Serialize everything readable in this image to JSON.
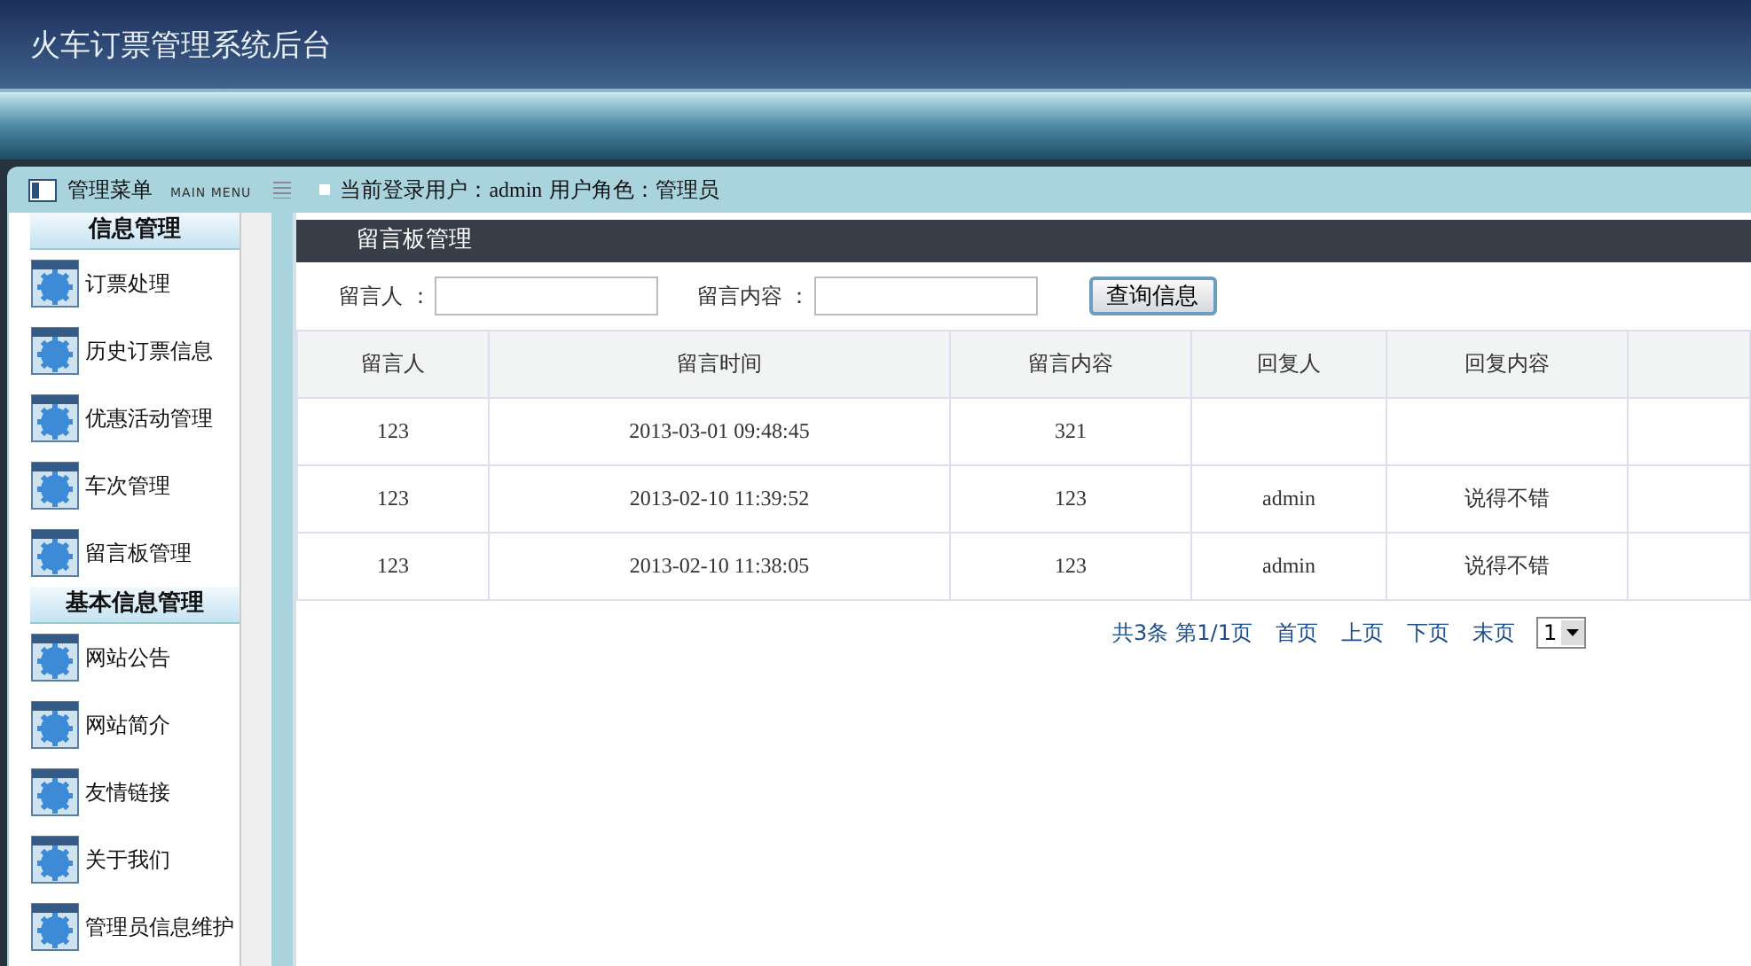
{
  "header": {
    "title": "火车订票管理系统后台"
  },
  "menu_bar": {
    "title": "管理菜单",
    "subtitle": "MAIN MENU",
    "user_info_label": "当前登录用户：",
    "user": "admin",
    "role_label": "用户角色：",
    "role": "管理员"
  },
  "sidebar": {
    "groups": [
      {
        "title": "信息管理",
        "items": [
          "订票处理",
          "历史订票信息",
          "优惠活动管理",
          "车次管理",
          "留言板管理"
        ]
      },
      {
        "title": "基本信息管理",
        "items": [
          "网站公告",
          "网站简介",
          "友情链接",
          "关于我们",
          "管理员信息维护"
        ]
      }
    ]
  },
  "panel": {
    "title": "留言板管理"
  },
  "search": {
    "fields": [
      {
        "label": "留言人 ："
      },
      {
        "label": "留言内容 ："
      }
    ],
    "button": "查询信息"
  },
  "table": {
    "columns": [
      "留言人",
      "留言时间",
      "留言内容",
      "回复人",
      "回复内容"
    ],
    "rows": [
      [
        "123",
        "2013-03-01 09:48:45",
        "321",
        "",
        ""
      ],
      [
        "123",
        "2013-02-10 11:39:52",
        "123",
        "admin",
        "说得不错"
      ],
      [
        "123",
        "2013-02-10 11:38:05",
        "123",
        "admin",
        "说得不错"
      ]
    ]
  },
  "pagination": {
    "total": "共3条",
    "page": "第1/1页",
    "links": [
      "首页",
      "上页",
      "下页",
      "末页"
    ],
    "page_select": "1"
  }
}
